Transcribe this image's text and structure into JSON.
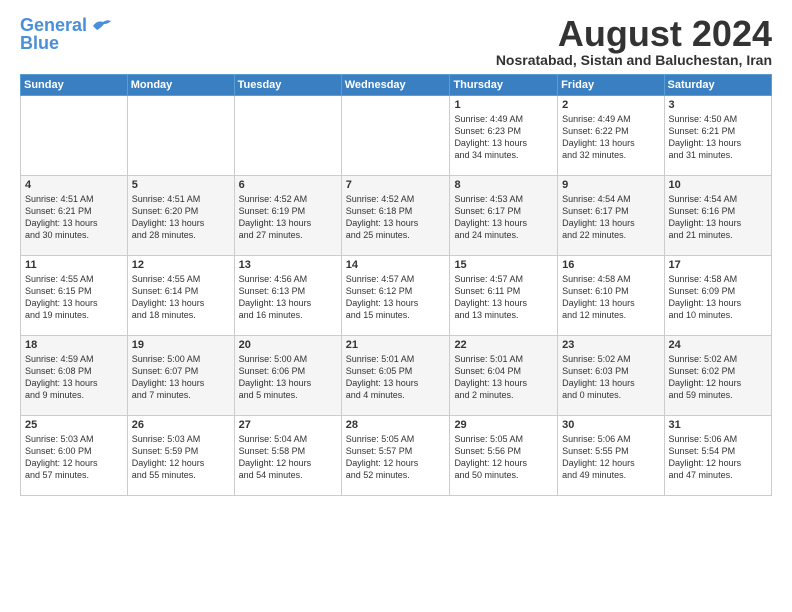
{
  "header": {
    "logo_general": "General",
    "logo_blue": "Blue",
    "month_title": "August 2024",
    "subtitle": "Nosratabad, Sistan and Baluchestan, Iran"
  },
  "calendar": {
    "days_of_week": [
      "Sunday",
      "Monday",
      "Tuesday",
      "Wednesday",
      "Thursday",
      "Friday",
      "Saturday"
    ],
    "weeks": [
      [
        {
          "day": "",
          "info": ""
        },
        {
          "day": "",
          "info": ""
        },
        {
          "day": "",
          "info": ""
        },
        {
          "day": "",
          "info": ""
        },
        {
          "day": "1",
          "info": "Sunrise: 4:49 AM\nSunset: 6:23 PM\nDaylight: 13 hours\nand 34 minutes."
        },
        {
          "day": "2",
          "info": "Sunrise: 4:49 AM\nSunset: 6:22 PM\nDaylight: 13 hours\nand 32 minutes."
        },
        {
          "day": "3",
          "info": "Sunrise: 4:50 AM\nSunset: 6:21 PM\nDaylight: 13 hours\nand 31 minutes."
        }
      ],
      [
        {
          "day": "4",
          "info": "Sunrise: 4:51 AM\nSunset: 6:21 PM\nDaylight: 13 hours\nand 30 minutes."
        },
        {
          "day": "5",
          "info": "Sunrise: 4:51 AM\nSunset: 6:20 PM\nDaylight: 13 hours\nand 28 minutes."
        },
        {
          "day": "6",
          "info": "Sunrise: 4:52 AM\nSunset: 6:19 PM\nDaylight: 13 hours\nand 27 minutes."
        },
        {
          "day": "7",
          "info": "Sunrise: 4:52 AM\nSunset: 6:18 PM\nDaylight: 13 hours\nand 25 minutes."
        },
        {
          "day": "8",
          "info": "Sunrise: 4:53 AM\nSunset: 6:17 PM\nDaylight: 13 hours\nand 24 minutes."
        },
        {
          "day": "9",
          "info": "Sunrise: 4:54 AM\nSunset: 6:17 PM\nDaylight: 13 hours\nand 22 minutes."
        },
        {
          "day": "10",
          "info": "Sunrise: 4:54 AM\nSunset: 6:16 PM\nDaylight: 13 hours\nand 21 minutes."
        }
      ],
      [
        {
          "day": "11",
          "info": "Sunrise: 4:55 AM\nSunset: 6:15 PM\nDaylight: 13 hours\nand 19 minutes."
        },
        {
          "day": "12",
          "info": "Sunrise: 4:55 AM\nSunset: 6:14 PM\nDaylight: 13 hours\nand 18 minutes."
        },
        {
          "day": "13",
          "info": "Sunrise: 4:56 AM\nSunset: 6:13 PM\nDaylight: 13 hours\nand 16 minutes."
        },
        {
          "day": "14",
          "info": "Sunrise: 4:57 AM\nSunset: 6:12 PM\nDaylight: 13 hours\nand 15 minutes."
        },
        {
          "day": "15",
          "info": "Sunrise: 4:57 AM\nSunset: 6:11 PM\nDaylight: 13 hours\nand 13 minutes."
        },
        {
          "day": "16",
          "info": "Sunrise: 4:58 AM\nSunset: 6:10 PM\nDaylight: 13 hours\nand 12 minutes."
        },
        {
          "day": "17",
          "info": "Sunrise: 4:58 AM\nSunset: 6:09 PM\nDaylight: 13 hours\nand 10 minutes."
        }
      ],
      [
        {
          "day": "18",
          "info": "Sunrise: 4:59 AM\nSunset: 6:08 PM\nDaylight: 13 hours\nand 9 minutes."
        },
        {
          "day": "19",
          "info": "Sunrise: 5:00 AM\nSunset: 6:07 PM\nDaylight: 13 hours\nand 7 minutes."
        },
        {
          "day": "20",
          "info": "Sunrise: 5:00 AM\nSunset: 6:06 PM\nDaylight: 13 hours\nand 5 minutes."
        },
        {
          "day": "21",
          "info": "Sunrise: 5:01 AM\nSunset: 6:05 PM\nDaylight: 13 hours\nand 4 minutes."
        },
        {
          "day": "22",
          "info": "Sunrise: 5:01 AM\nSunset: 6:04 PM\nDaylight: 13 hours\nand 2 minutes."
        },
        {
          "day": "23",
          "info": "Sunrise: 5:02 AM\nSunset: 6:03 PM\nDaylight: 13 hours\nand 0 minutes."
        },
        {
          "day": "24",
          "info": "Sunrise: 5:02 AM\nSunset: 6:02 PM\nDaylight: 12 hours\nand 59 minutes."
        }
      ],
      [
        {
          "day": "25",
          "info": "Sunrise: 5:03 AM\nSunset: 6:00 PM\nDaylight: 12 hours\nand 57 minutes."
        },
        {
          "day": "26",
          "info": "Sunrise: 5:03 AM\nSunset: 5:59 PM\nDaylight: 12 hours\nand 55 minutes."
        },
        {
          "day": "27",
          "info": "Sunrise: 5:04 AM\nSunset: 5:58 PM\nDaylight: 12 hours\nand 54 minutes."
        },
        {
          "day": "28",
          "info": "Sunrise: 5:05 AM\nSunset: 5:57 PM\nDaylight: 12 hours\nand 52 minutes."
        },
        {
          "day": "29",
          "info": "Sunrise: 5:05 AM\nSunset: 5:56 PM\nDaylight: 12 hours\nand 50 minutes."
        },
        {
          "day": "30",
          "info": "Sunrise: 5:06 AM\nSunset: 5:55 PM\nDaylight: 12 hours\nand 49 minutes."
        },
        {
          "day": "31",
          "info": "Sunrise: 5:06 AM\nSunset: 5:54 PM\nDaylight: 12 hours\nand 47 minutes."
        }
      ]
    ]
  }
}
